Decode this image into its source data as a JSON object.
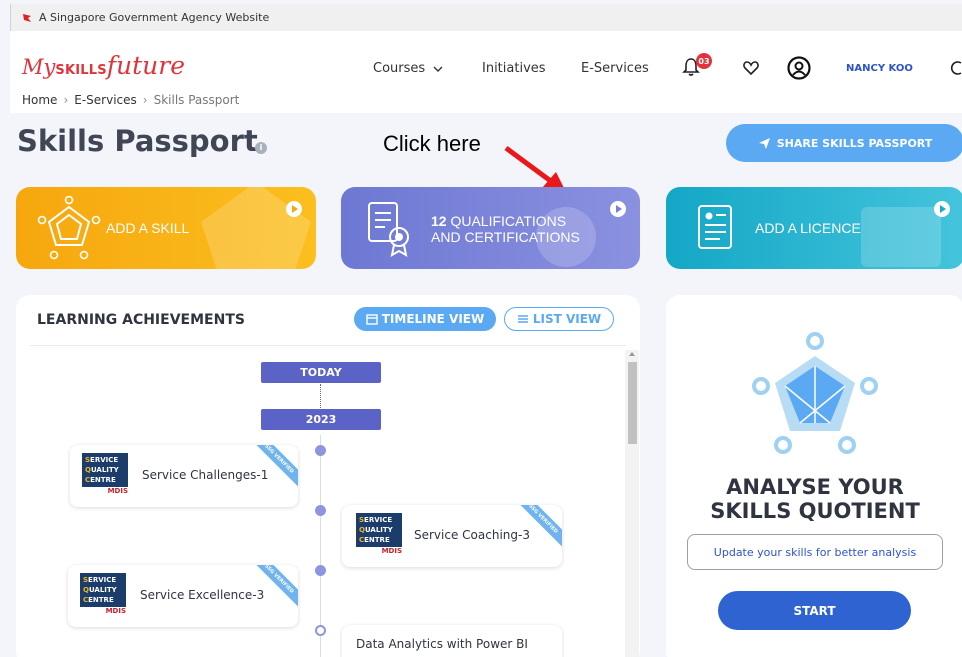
{
  "gov_banner": {
    "text": "A Singapore Government Agency Website",
    "icon": "lion-head-icon"
  },
  "brand": {
    "my": "My",
    "skills": "SKILLS",
    "future": "future",
    "color": "#e1343a"
  },
  "nav": {
    "courses": "Courses",
    "initiatives": "Initiatives",
    "eservices": "E-Services",
    "notification_count": "03",
    "user_name": "NANCY KOO"
  },
  "breadcrumb": {
    "home": "Home",
    "eservices": "E-Services",
    "current": "Skills Passport"
  },
  "page": {
    "title": "Skills Passport",
    "info_icon": "i",
    "share_button": "SHARE SKILLS PASSPORT",
    "annotation": "Click here"
  },
  "cards": {
    "skill": "ADD A SKILL",
    "qual_count": "12",
    "qual_line1": "QUALIFICATIONS",
    "qual_line2": "AND CERTIFICATIONS",
    "licence": "ADD A LICENCE"
  },
  "learning": {
    "title": "LEARNING ACHIEVEMENTS",
    "timeline_btn": "TIMELINE VIEW",
    "list_btn": "LIST VIEW",
    "today": "TODAY",
    "year": "2023",
    "ribbon": "SSG VERIFIED",
    "logo_lines": [
      "ERVICE",
      "UALITY",
      "ENTRE"
    ],
    "logo_letters": [
      "S",
      "Q",
      "C"
    ],
    "logo_sub": "MDIS",
    "items": [
      {
        "title": "Service Challenges-1"
      },
      {
        "title": "Service Coaching-3"
      },
      {
        "title": "Service Excellence-3"
      },
      {
        "title": "Data Analytics with Power BI"
      }
    ]
  },
  "analyse": {
    "title_line1": "ANALYSE YOUR",
    "title_line2": "SKILLS QUOTIENT",
    "update_text": "Update your skills for better analysis",
    "start": "START"
  },
  "colors": {
    "accent_blue": "#5aa9f2",
    "skill_card": "#f6a70e",
    "qual_card": "#7a82d8",
    "licence_card": "#1aa9c7",
    "timeline_pill": "#5b64c6",
    "start_button": "#2f63d1",
    "annotation_arrow": "#e8181b"
  }
}
